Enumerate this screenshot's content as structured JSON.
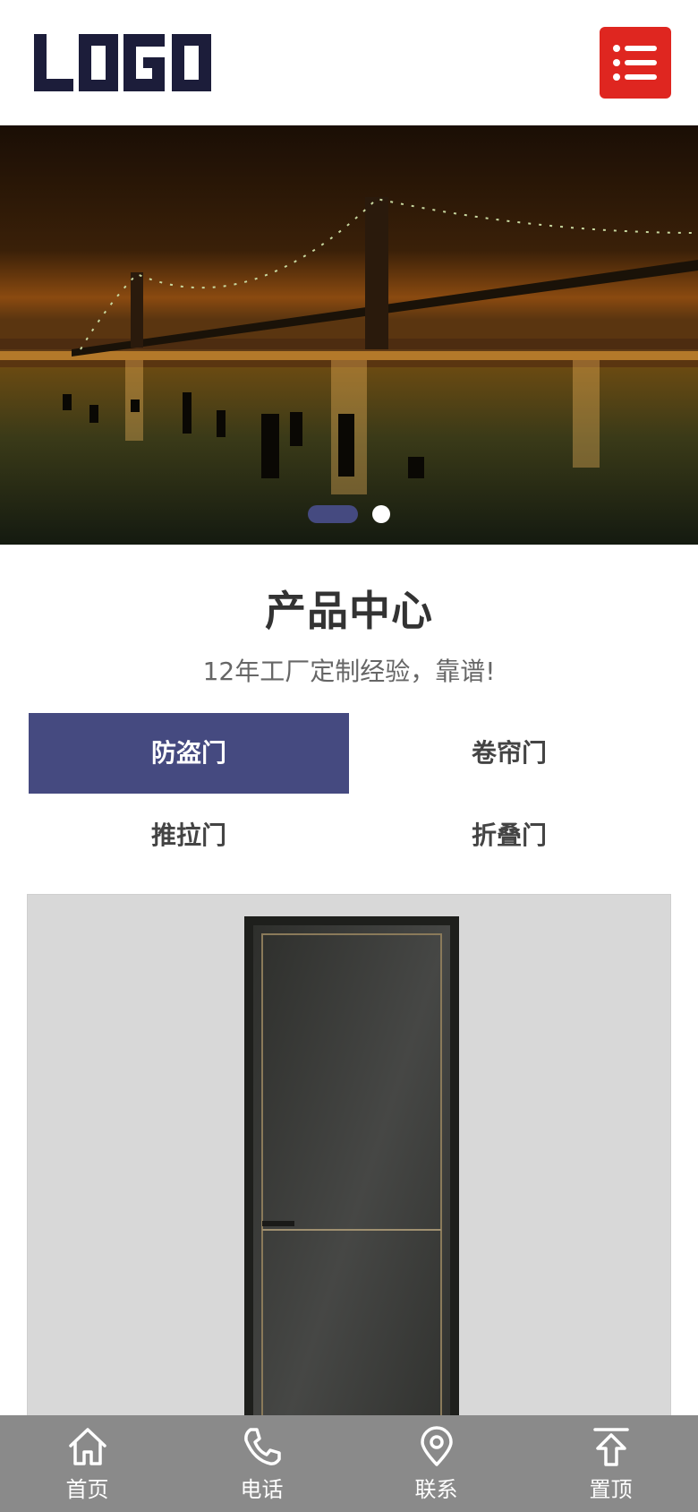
{
  "header": {
    "logo_text": "LOGO",
    "logo_color": "#1c1d3a",
    "menu_icon": "list-menu-icon",
    "menu_color": "#df2620"
  },
  "banner": {
    "slides": 2,
    "active_slide": 1,
    "accent": "#454a80"
  },
  "products": {
    "title": "产品中心",
    "subtitle": "12年工厂定制经验，靠谱!",
    "tabs": [
      {
        "label": "防盗门",
        "active": true
      },
      {
        "label": "卷帘门",
        "active": false
      },
      {
        "label": "推拉门",
        "active": false
      },
      {
        "label": "折叠门",
        "active": false
      }
    ],
    "active_tab_color": "#454a80"
  },
  "bottom_nav": {
    "items": [
      {
        "label": "首页",
        "icon": "home-icon"
      },
      {
        "label": "电话",
        "icon": "phone-icon"
      },
      {
        "label": "联系",
        "icon": "location-pin-icon"
      },
      {
        "label": "置顶",
        "icon": "arrow-up-icon"
      }
    ],
    "background": "#8a8a8a"
  }
}
